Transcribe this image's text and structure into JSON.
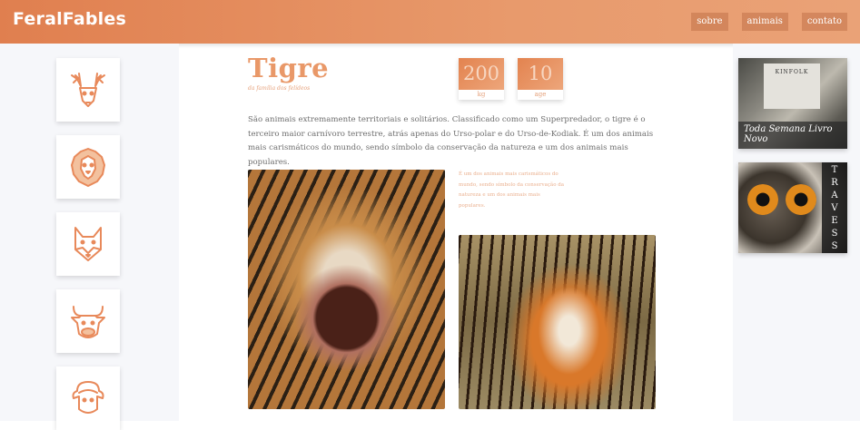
{
  "header": {
    "logo": "FeralFables",
    "nav": [
      {
        "label": "sobre"
      },
      {
        "label": "animais"
      },
      {
        "label": "contato"
      }
    ]
  },
  "sidebar": {
    "animals": [
      {
        "icon": "deer-icon"
      },
      {
        "icon": "lion-icon"
      },
      {
        "icon": "fox-icon"
      },
      {
        "icon": "bull-icon"
      },
      {
        "icon": "sheep-icon"
      }
    ]
  },
  "main": {
    "title": "Tigre",
    "subtitle": "da família dos felídeos",
    "stats": [
      {
        "value": "200",
        "unit": "kg"
      },
      {
        "value": "10",
        "unit": "age"
      }
    ],
    "description": "São animais extremamente territoriais e solitários. Classificado como um Superpredador, o tigre é o terceiro maior carnívoro terrestre, atrás apenas do Urso-polar e do Urso-de-Kodiak. É um dos animais mais carismáticos do mundo, sendo símbolo da conservação da natureza e um dos animais mais populares.",
    "quote": "É um dos animais mais carismáticos do mundo, sendo símbolo da conservação da natureza e um dos animais mais populares."
  },
  "ads": [
    {
      "brand": "KINFOLK",
      "caption": "Toda Semana Livro Novo"
    },
    {
      "caption": "TRAVESSA"
    }
  ],
  "colors": {
    "accent": "#e8956a",
    "header_start": "#e07f4f",
    "header_end": "#eaa277",
    "icon_stroke": "#e8895a",
    "sidebar_bg": "#f6f7fa"
  }
}
